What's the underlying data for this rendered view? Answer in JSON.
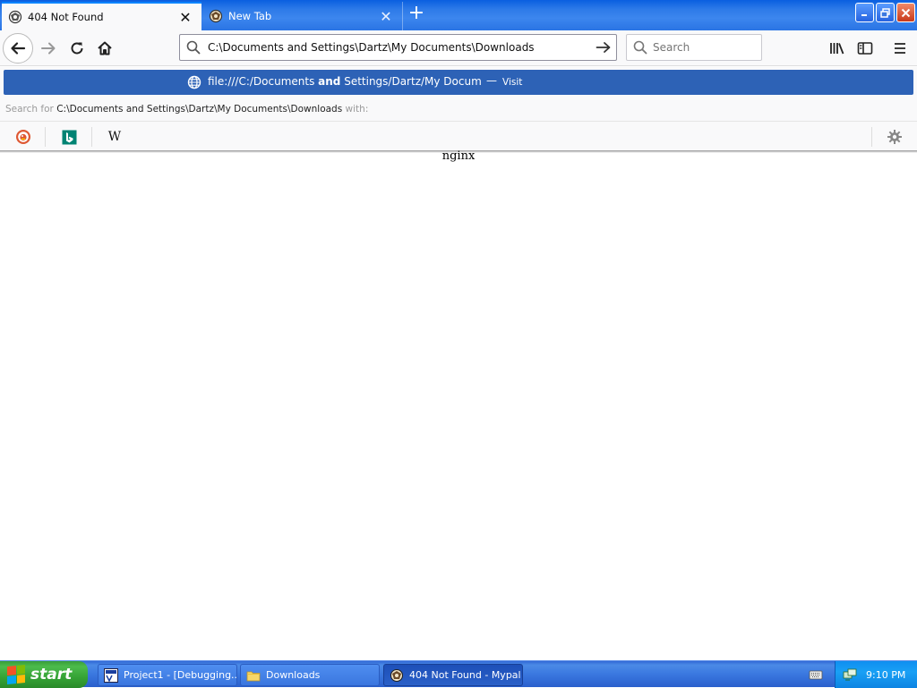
{
  "browser": {
    "tabs": [
      {
        "title": "404 Not Found",
        "active": true,
        "favicon": "mypal-icon"
      },
      {
        "title": "New Tab",
        "active": false,
        "favicon": "mypal-icon"
      }
    ],
    "urlbar": {
      "value": "C:\\Documents and Settings\\Dartz\\My Documents\\Downloads",
      "placeholder": ""
    },
    "searchbar": {
      "placeholder": "Search"
    }
  },
  "popup": {
    "suggestion": {
      "url_prefix": "file:///C:/Documents ",
      "url_bold": "and",
      "url_suffix": " Settings/Dartz/My Documents/Downloads",
      "separator": "—",
      "action": "Visit"
    },
    "search_for": {
      "prefix": "Search for",
      "term": "C:\\Documents and Settings\\Dartz\\My Documents\\Downloads",
      "suffix": "with:"
    },
    "engines": [
      "duckduckgo-icon",
      "bing-icon",
      "wikipedia-icon"
    ],
    "wiki_glyph": "W"
  },
  "page": {
    "server_text": "nginx"
  },
  "taskbar": {
    "start_label": "start",
    "tasks": [
      {
        "label": "Project1 - [Debugging...",
        "active": false
      },
      {
        "label": "Downloads",
        "active": false
      },
      {
        "label": "404 Not Found - Mypal",
        "active": true
      }
    ],
    "clock": "9:10 PM"
  },
  "colors": {
    "suggestion_highlight": "#2d62b6",
    "tab_accent": "#0a84ff",
    "xp_taskbar": "#3a78e0",
    "xp_start": "#36a336"
  }
}
